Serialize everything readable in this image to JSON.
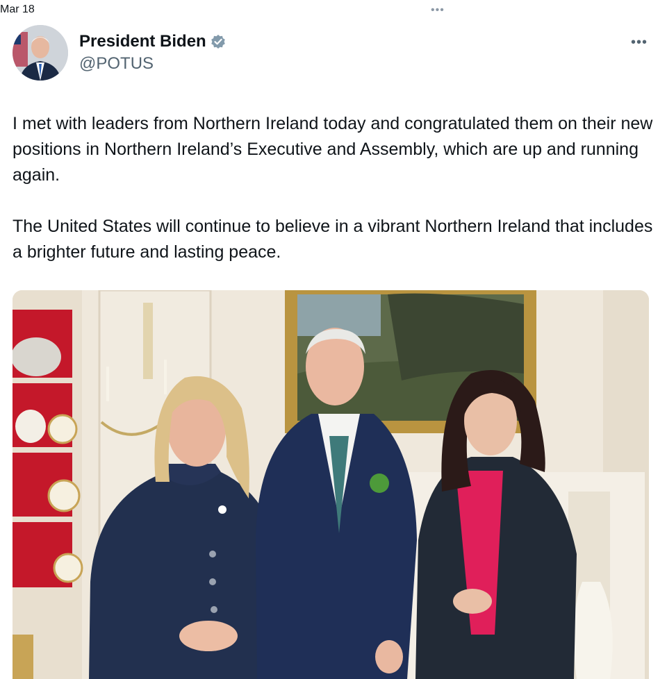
{
  "topbar": {
    "date": "Mar 18",
    "more_icon": "ellipsis-horizontal-icon"
  },
  "author": {
    "name": "President Biden",
    "handle": "@POTUS",
    "verified": true,
    "verified_color": "#829aab"
  },
  "tweet": {
    "paragraphs": [
      "I met with leaders from Northern Ireland today and congratulated them on their new positions in Northern Ireland’s Executive and Assembly, which are up and running again.",
      "The United States will continue to believe in a vibrant Northern Ireland that includes a brighter future and lasting peace."
    ]
  },
  "media": {
    "type": "photo"
  }
}
